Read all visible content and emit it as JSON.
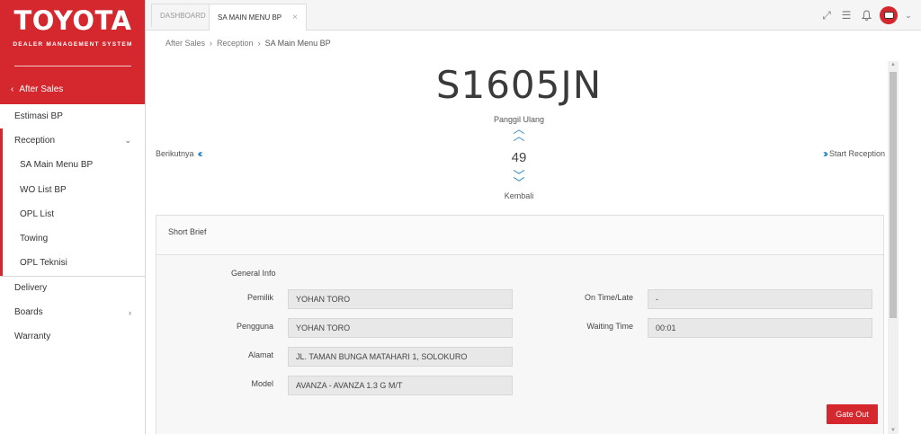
{
  "brand": {
    "logo": "TOYOTA",
    "subtitle": "DEALER MANAGEMENT SYSTEM",
    "back_label": "After Sales"
  },
  "sidebar": {
    "items": [
      {
        "label": "Estimasi BP"
      },
      {
        "label": "Reception"
      },
      {
        "label": "SA Main Menu BP"
      },
      {
        "label": "WO List BP"
      },
      {
        "label": "OPL List"
      },
      {
        "label": "Towing"
      },
      {
        "label": "OPL Teknisi"
      },
      {
        "label": "Delivery"
      },
      {
        "label": "Boards"
      },
      {
        "label": "Warranty"
      }
    ]
  },
  "tabs": [
    {
      "label": "DASHBOARD"
    },
    {
      "label": "SA MAIN MENU BP"
    }
  ],
  "breadcrumb": {
    "part1": "After Sales",
    "part2": "Reception",
    "part3": "SA Main Menu BP"
  },
  "queue": {
    "plate": "S1605JN",
    "recall_label": "Panggil Ulang",
    "number": "49",
    "back_label": "Kembali",
    "next_label": "Berikutnya",
    "start_label": "Start Reception"
  },
  "panel": {
    "title": "Short Brief",
    "section": "General Info",
    "fields": {
      "pemilik_label": "Pemilik",
      "pemilik_value": "YOHAN TORO",
      "pengguna_label": "Pengguna",
      "pengguna_value": "YOHAN TORO",
      "alamat_label": "Alamat",
      "alamat_value": "JL. TAMAN BUNGA MATAHARI 1, SOLOKURO",
      "model_label": "Model",
      "model_value": "AVANZA - AVANZA 1.3 G M/T",
      "ontime_label": "On Time/Late",
      "ontime_value": "-",
      "waiting_label": "Waiting Time",
      "waiting_value": "00:01"
    },
    "gate_out": "Gate Out"
  },
  "colors": {
    "brand_red": "#d5272e",
    "accent_blue": "#2b87c9"
  },
  "icons": [
    "fullscreen-icon",
    "menu-icon",
    "bell-icon",
    "user-avatar-icon"
  ]
}
